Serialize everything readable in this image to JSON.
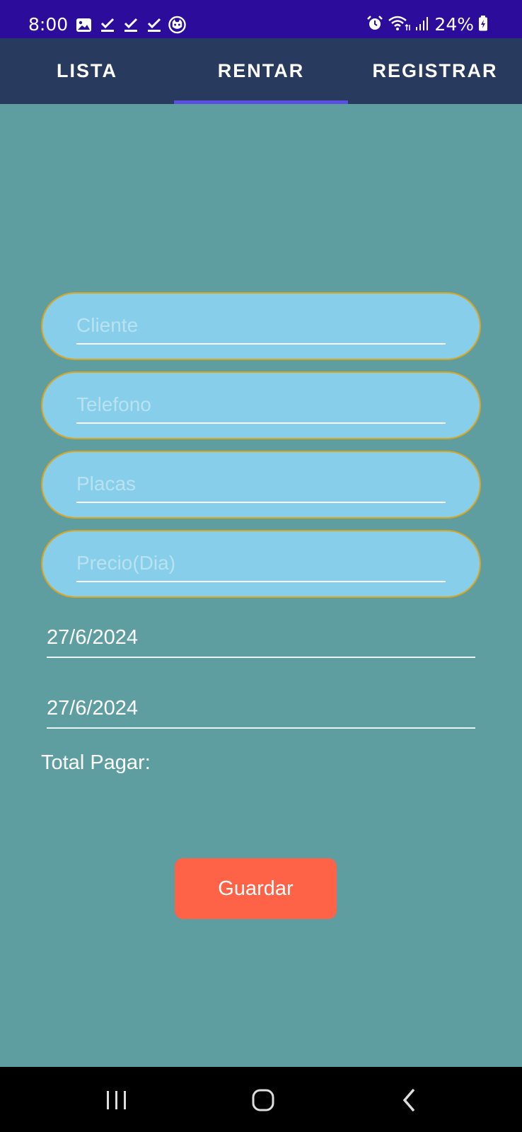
{
  "status_bar": {
    "time": "8:00",
    "battery": "24%",
    "left_icons": [
      "image-icon",
      "check-icon",
      "check-icon",
      "check-icon",
      "cat-icon"
    ],
    "right_icons": [
      "alarm-icon",
      "wifi-icon",
      "signal-icon",
      "battery-icon"
    ]
  },
  "tabs": [
    {
      "label": "LISTA",
      "active": false
    },
    {
      "label": "RENTAR",
      "active": true
    },
    {
      "label": "REGISTRAR",
      "active": false
    }
  ],
  "form": {
    "cliente_placeholder": "Cliente",
    "telefono_placeholder": "Telefono",
    "placas_placeholder": "Placas",
    "precio_placeholder": "Precio(Dia)",
    "start_date": "27/6/2024",
    "end_date": "27/6/2024",
    "total_label": "Total Pagar:",
    "save_label": "Guardar"
  },
  "nav_bar": {
    "icons": [
      "recent-apps-icon",
      "home-icon",
      "back-icon"
    ]
  },
  "colors": {
    "status_bar": "#2c0c9a",
    "tab_bar": "#283a5e",
    "tab_indicator": "#5b4ee0",
    "background": "#5f9ea0",
    "field_fill": "#87ceeb",
    "field_border": "#d9a520",
    "button": "#ff6347"
  }
}
